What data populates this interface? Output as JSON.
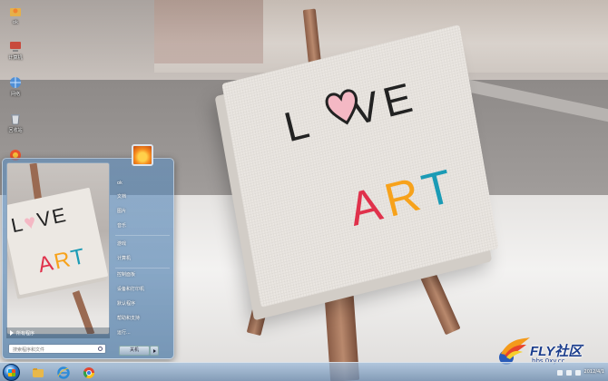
{
  "desktop": {
    "icons": [
      {
        "label": "ok",
        "icon": "user-folder-icon"
      },
      {
        "label": "计算机",
        "icon": "computer-icon"
      },
      {
        "label": "网络",
        "icon": "network-icon"
      },
      {
        "label": "回收站",
        "icon": "recycle-bin-icon"
      },
      {
        "label": "",
        "icon": "browser-icon"
      }
    ],
    "wallpaper": {
      "text_love": "LOVE",
      "text_art": "ART"
    }
  },
  "start_menu": {
    "all_programs": "所有程序",
    "search_placeholder": "搜索程序和文件",
    "right_items": [
      {
        "label": "ok"
      },
      {
        "label": "文档"
      },
      {
        "label": "图片"
      },
      {
        "label": "音乐"
      },
      {
        "label": "游戏"
      },
      {
        "label": "计算机"
      },
      {
        "label": "控制面板"
      },
      {
        "label": "设备和打印机"
      },
      {
        "label": "默认程序"
      },
      {
        "label": "帮助和支持"
      },
      {
        "label": "运行..."
      }
    ],
    "shutdown_label": "关机"
  },
  "taskbar": {
    "pinned": [
      "windows-explorer-icon",
      "internet-explorer-icon",
      "chrome-icon"
    ],
    "clock_date": "2012/4/1"
  },
  "watermark": {
    "title": "FLY社区",
    "url": "bbs.0xy.cc"
  },
  "colors": {
    "accent": "#2d73c2",
    "love_heart": "#f4b8c4",
    "art_a": "#e0314b",
    "art_r": "#f7a21b",
    "art_t": "#1b9bb5"
  }
}
